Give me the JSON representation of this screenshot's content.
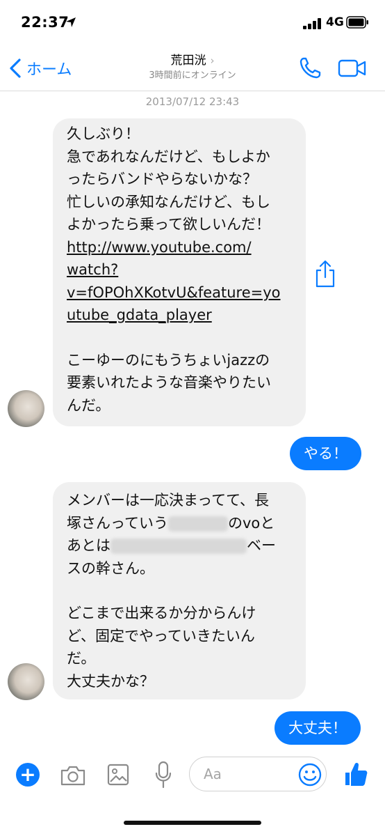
{
  "status": {
    "time": "22:37",
    "network": "4G"
  },
  "nav": {
    "back_label": "ホーム",
    "title": "荒田洸",
    "title_chevron": "›",
    "subtitle": "3時間前にオンライン"
  },
  "timestamp": "2013/07/12 23:43",
  "messages": {
    "m1": {
      "lines": [
        "久しぶり！",
        "急であれなんだけど、もしよか",
        "ったらバンドやらないかな？",
        "忙しいの承知なんだけど、もし",
        "よかったら乗って欲しいんだ！"
      ],
      "link": [
        "http://www.youtube.com/",
        "watch?",
        "v=fOPOhXKotvU&feature=yo",
        "utube_gdata_player"
      ],
      "tail": [
        "こーゆーのにもうちょいjazzの",
        "要素いれたような音楽やりたい",
        "んだ。"
      ]
    },
    "m2": {
      "text": "やる！"
    },
    "m3": {
      "line1": "メンバーは一応決まってて、長",
      "line2_a": "塚さんっていう",
      "line2_b": "のvoと",
      "line3_a": "あとは",
      "line3_b": "ベー",
      "line4": "スの幹さん。",
      "line5": "どこまで出来るか分からんけ",
      "line6": "ど、固定でやっていきたいん",
      "line7": "だ。",
      "line8": "大丈夫かな？"
    },
    "m4": {
      "text": "大丈夫！"
    }
  },
  "composer": {
    "placeholder": "Aa"
  },
  "icons": {
    "back": "chevron-left-icon",
    "phone": "phone-icon",
    "video": "video-camera-icon",
    "share": "share-icon",
    "plus": "plus-icon",
    "camera": "camera-icon",
    "image": "image-icon",
    "mic": "microphone-icon",
    "emoji": "smiley-icon",
    "like": "thumbs-up-icon"
  },
  "colors": {
    "accent": "#0a7cff",
    "incoming_bubble": "#f0f0f0",
    "outgoing_text": "#ffffff"
  }
}
